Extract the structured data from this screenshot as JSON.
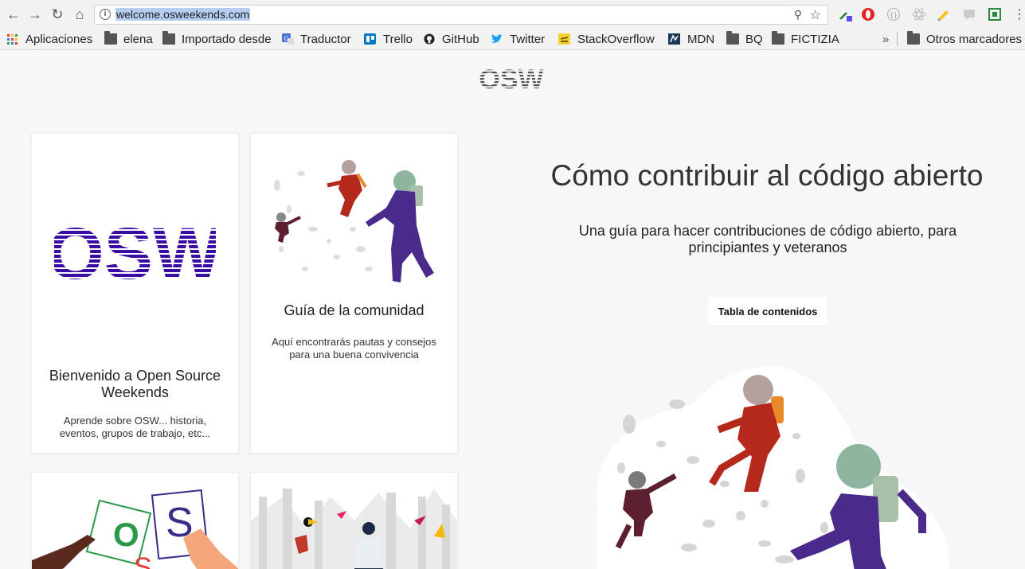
{
  "browser": {
    "url": "welcome.osweekends.com",
    "nav": {
      "back": "←",
      "forward": "→",
      "reload": "↻",
      "home": "⌂"
    },
    "more_bookmarks": "»"
  },
  "bookmarks": [
    {
      "label": "Aplicaciones",
      "icon": "apps-grid-icon"
    },
    {
      "label": "elena",
      "icon": "folder-icon"
    },
    {
      "label": "Importado desde",
      "icon": "folder-icon"
    },
    {
      "label": "Traductor",
      "icon": "translate-icon"
    },
    {
      "label": "Trello",
      "icon": "trello-icon"
    },
    {
      "label": "GitHub",
      "icon": "github-icon"
    },
    {
      "label": "Twitter",
      "icon": "twitter-icon"
    },
    {
      "label": "StackOverflow",
      "icon": "stackoverflow-icon"
    },
    {
      "label": "MDN",
      "icon": "mdn-icon"
    },
    {
      "label": "BQ",
      "icon": "folder-icon"
    },
    {
      "label": "FICTIZIA",
      "icon": "folder-icon"
    },
    {
      "label": "Otros marcadores",
      "icon": "folder-icon"
    }
  ],
  "site": {
    "logo_text": "OSW",
    "cards": [
      {
        "title": "Bienvenido a Open Source Weekends",
        "desc": "Aprende sobre OSW... historia, eventos, grupos de trabajo, etc..."
      },
      {
        "title": "Guía de la comunidad",
        "desc": "Aquí encontrarás pautas y consejos para una buena convivencia"
      }
    ],
    "os_cards": {
      "letter_o": "O",
      "letter_s": "S",
      "letter_s2": "S"
    },
    "hero": {
      "title": "Cómo contribuir al código abierto",
      "subtitle": "Una guía para hacer contribuciones de código abierto, para principiantes y veteranos",
      "toc_button": "Tabla de contenidos"
    }
  },
  "colors": {
    "brand_purple": "#3a0ca3",
    "astronaut_red": "#b5281c",
    "astronaut_purple": "#4a2a8a",
    "astronaut_dark": "#5b1f2e"
  }
}
